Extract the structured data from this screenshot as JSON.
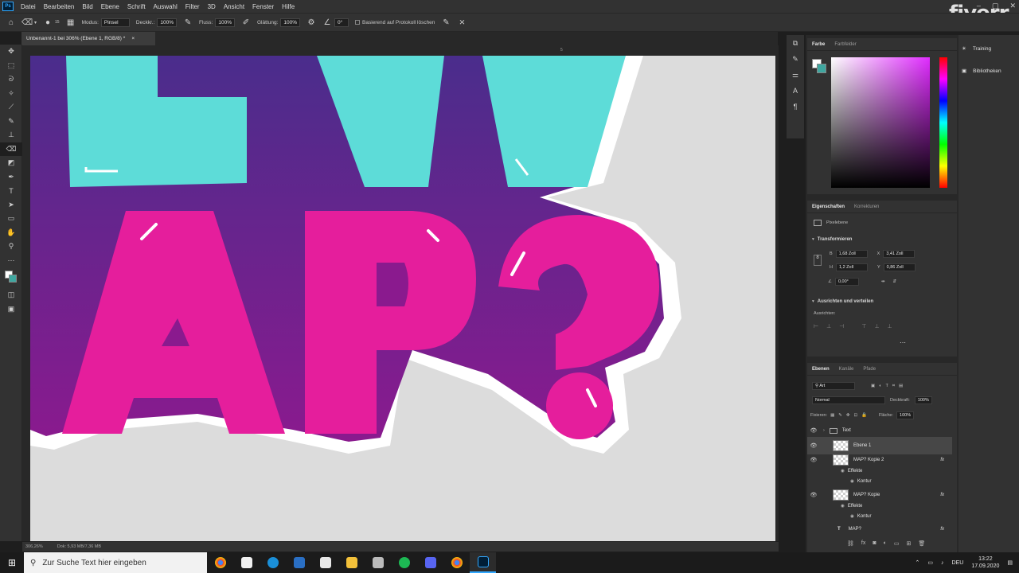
{
  "menu": {
    "items": [
      "Datei",
      "Bearbeiten",
      "Bild",
      "Ebene",
      "Schrift",
      "Auswahl",
      "Filter",
      "3D",
      "Ansicht",
      "Fenster",
      "Hilfe"
    ]
  },
  "options": {
    "modus_label": "Modus:",
    "modus_value": "Pinsel",
    "deckkr_label": "Deckkr.:",
    "deckkr_value": "100%",
    "fluss_label": "Fluss:",
    "fluss_value": "100%",
    "glaettung_label": "Glättung:",
    "glaettung_value": "100%",
    "angle_value": "0°",
    "protokoll_label": "Basierend auf Protokoll löschen",
    "brush_size": "15"
  },
  "document": {
    "tab_title": "Unbenannt-1 bei 306% (Ebene 1, RGB/8) *"
  },
  "status": {
    "zoom": "306,26%",
    "doc": "Dok: 5,93 MB/7,36 MB"
  },
  "ruler": {
    "tick": "5"
  },
  "color_panel": {
    "tab1": "Farbe",
    "tab2": "Farbfelder"
  },
  "right": {
    "training": "Training",
    "bibliothek": "Bibliotheken"
  },
  "properties": {
    "tab1": "Eigenschaften",
    "tab2": "Korrekturen",
    "type": "Pixelebene",
    "transform_head": "Transformieren",
    "b_label": "B",
    "b_value": "1,68 Zoll",
    "h_label": "H",
    "h_value": "1,2 Zoll",
    "x_label": "X",
    "x_value": "3,41 Zoll",
    "y_label": "Y",
    "y_value": "0,86 Zoll",
    "angle": "0,00°",
    "align_head": "Ausrichten und verteilen",
    "align_label": "Ausrichten:"
  },
  "layers": {
    "tab1": "Ebenen",
    "tab2": "Kanäle",
    "tab3": "Pfade",
    "filter": "Art",
    "blend": "Normal",
    "opacity_label": "Deckkraft:",
    "opacity_value": "100%",
    "lock_label": "Fixieren:",
    "fill_label": "Fläche:",
    "fill_value": "100%",
    "group": "Text",
    "layer1": "Ebene 1",
    "layer2": "MAP? Kopie 2",
    "layer3": "MAP? Kopie",
    "layer4": "MAP?",
    "effekte": "Effekte",
    "kontur": "Kontur",
    "fx": "fx"
  },
  "taskbar": {
    "search_placeholder": "Zur Suche Text hier eingeben",
    "lang": "DEU",
    "time": "13:22",
    "date": "17.09.2020"
  },
  "watermark": "fiverr"
}
